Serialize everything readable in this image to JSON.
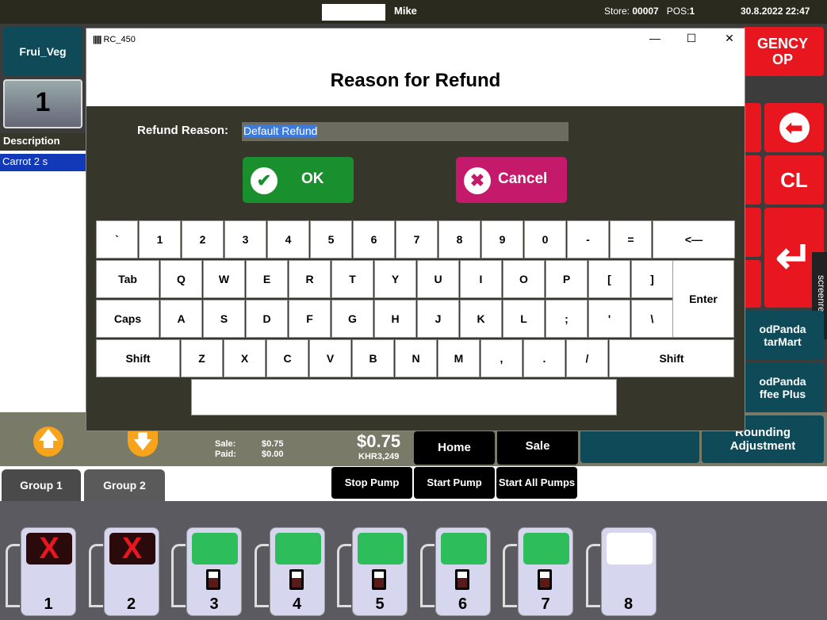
{
  "topbar": {
    "user": "Mike",
    "store_label": "Store:",
    "store_value": "00007",
    "pos_label": "POS:",
    "pos_value": "1",
    "datetime": "30.8.2022 22:47"
  },
  "left": {
    "category": "Frui_Veg",
    "qty": "1",
    "description_header": "Description",
    "item": "Carrot 2 s"
  },
  "right": {
    "emergency": "GENCY",
    "emergency2": "OP",
    "clear": "CL",
    "foodpanda1": "odPanda",
    "foodpanda1b": "tarMart",
    "foodpanda2": "odPanda",
    "foodpanda2b": "ffee Plus",
    "rounding": "Rounding Adjustment",
    "watermark": "screenrec"
  },
  "dialog": {
    "window_caption": "RC_450",
    "title": "Reason for Refund",
    "reason_label": "Refund Reason:",
    "reason_value": "Default Refund",
    "ok": "OK",
    "cancel": "Cancel"
  },
  "keyboard": {
    "row1": [
      "`",
      "1",
      "2",
      "3",
      "4",
      "5",
      "6",
      "7",
      "8",
      "9",
      "0",
      "-",
      "=",
      "<—"
    ],
    "row2": [
      "Tab",
      "Q",
      "W",
      "E",
      "R",
      "T",
      "Y",
      "U",
      "I",
      "O",
      "P",
      "[",
      "]"
    ],
    "row3": [
      "Caps",
      "A",
      "S",
      "D",
      "F",
      "G",
      "H",
      "J",
      "K",
      "L",
      ";",
      "'",
      "\\"
    ],
    "row4": [
      "Shift",
      "Z",
      "X",
      "C",
      "V",
      "B",
      "N",
      "M",
      ",",
      ".",
      "/",
      "Shift"
    ],
    "enter": "Enter"
  },
  "totals": {
    "sale_label": "Sale:",
    "sale_value": "$0.75",
    "paid_label": "Paid:",
    "paid_value": "$0.00",
    "total": "$0.75",
    "khr": "KHR3,249"
  },
  "buttons": {
    "home": "Home",
    "cancel_sale": "Sale",
    "cancel_sale_top": "Cancel",
    "stop_pump": "Stop Pump",
    "start_pump": "Start Pump",
    "start_all": "Start All Pumps"
  },
  "groups": [
    "Group 1",
    "Group 2"
  ],
  "pumps": [
    {
      "num": "1",
      "state": "error"
    },
    {
      "num": "2",
      "state": "error"
    },
    {
      "num": "3",
      "state": "ready"
    },
    {
      "num": "4",
      "state": "ready"
    },
    {
      "num": "5",
      "state": "ready"
    },
    {
      "num": "6",
      "state": "ready"
    },
    {
      "num": "7",
      "state": "ready"
    },
    {
      "num": "8",
      "state": "idle"
    }
  ],
  "colors": {
    "ok": "#1a8f2e",
    "cancel": "#c51a6b",
    "teal": "#0e4a58",
    "red": "#e8171f",
    "pump_ready": "#2dbd5a",
    "pump_error": "#e8171f"
  }
}
